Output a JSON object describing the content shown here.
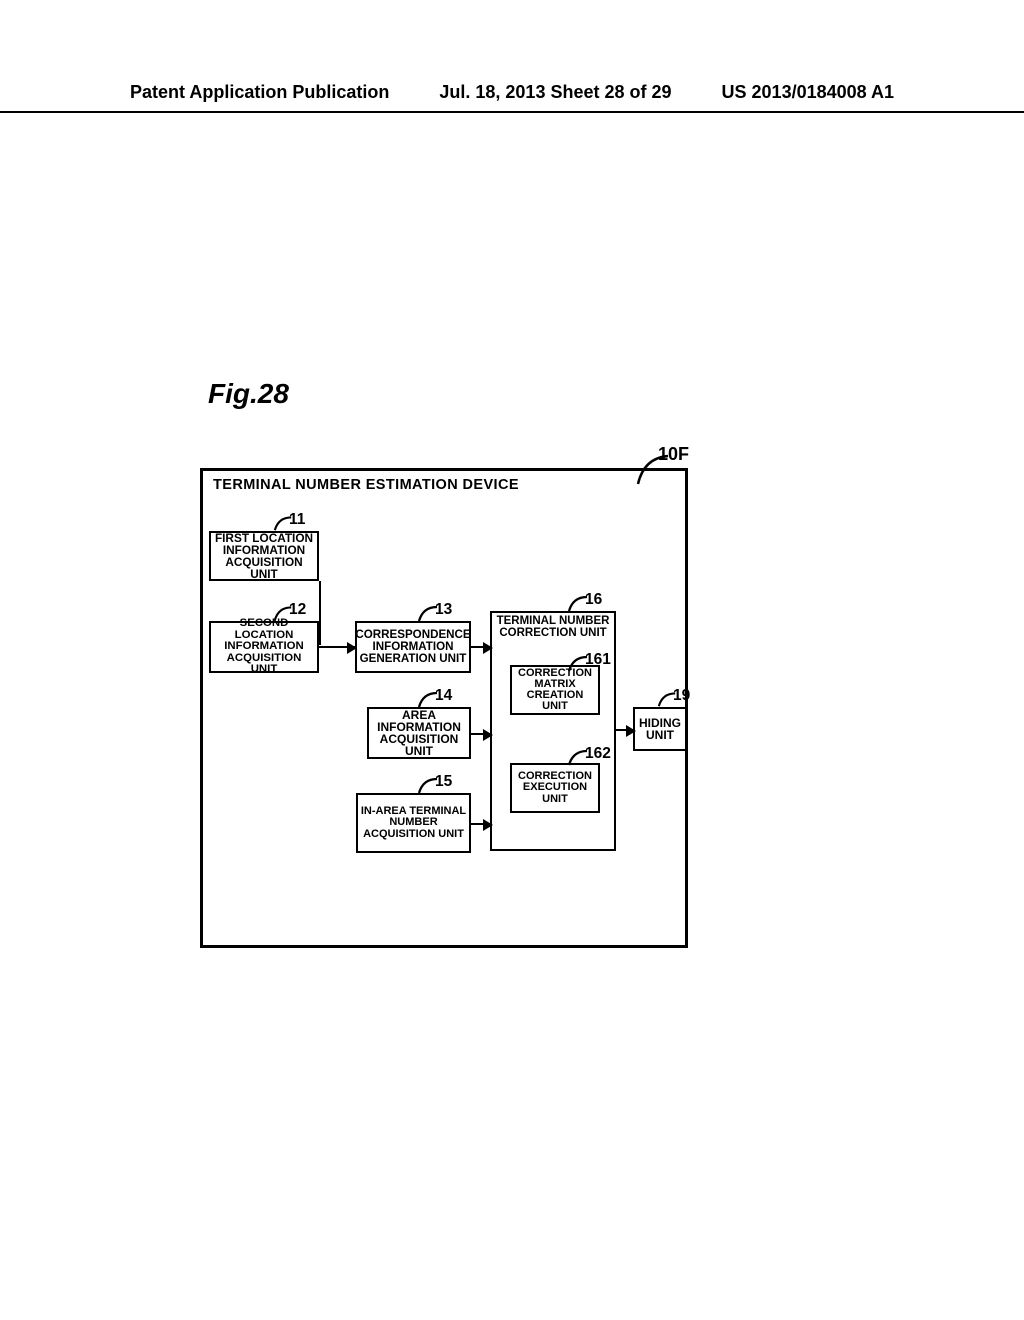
{
  "header": {
    "left": "Patent Application Publication",
    "center": "Jul. 18, 2013  Sheet 28 of 29",
    "right": "US 2013/0184008 A1"
  },
  "figure_label": "Fig.28",
  "device": {
    "ref": "10F",
    "title": "TERMINAL NUMBER ESTIMATION DEVICE"
  },
  "blocks": {
    "b11": {
      "ref": "11",
      "label": "FIRST LOCATION\nINFORMATION\nACQUISITION UNIT"
    },
    "b12": {
      "ref": "12",
      "label": "SECOND LOCATION\nINFORMATION\nACQUISITION UNIT"
    },
    "b13": {
      "ref": "13",
      "label": "CORRESPONDENCE\nINFORMATION\nGENERATION UNIT"
    },
    "b14": {
      "ref": "14",
      "label": "AREA\nINFORMATION\nACQUISITION UNIT"
    },
    "b15": {
      "ref": "15",
      "label": "IN-AREA TERMINAL\nNUMBER\nACQUISITION UNIT"
    },
    "b16": {
      "ref": "16",
      "label": "TERMINAL NUMBER\nCORRECTION UNIT"
    },
    "b161": {
      "ref": "161",
      "label": "CORRECTION\nMATRIX CREATION\nUNIT"
    },
    "b162": {
      "ref": "162",
      "label": "CORRECTION\nEXECUTION\nUNIT"
    },
    "b19": {
      "ref": "19",
      "label": "HIDING\nUNIT"
    }
  }
}
